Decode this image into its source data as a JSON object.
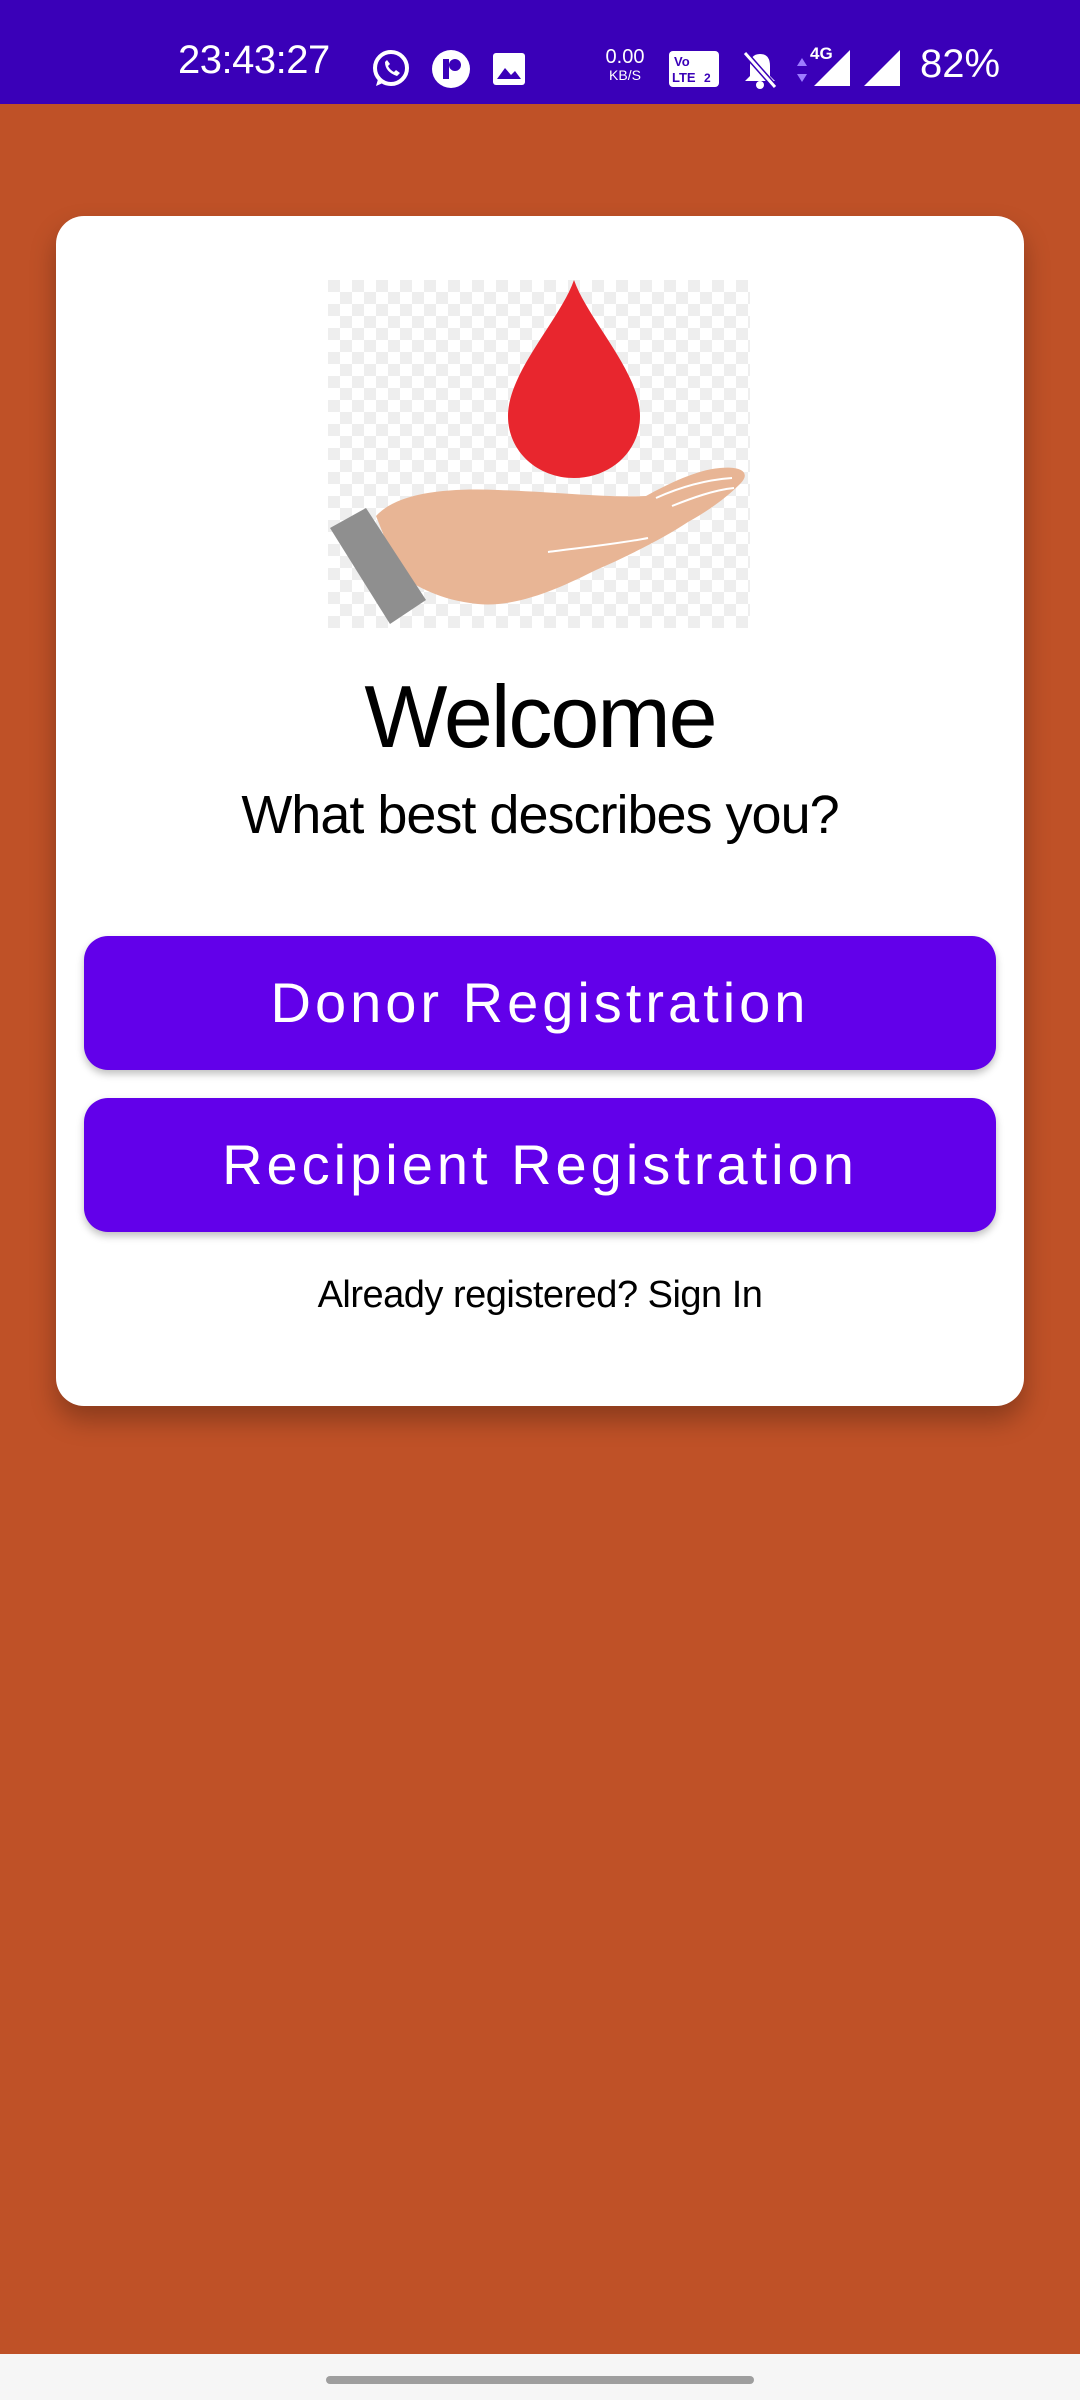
{
  "status_bar": {
    "time": "23:43:27",
    "net_speed_value": "0.00",
    "net_speed_unit": "KB/S",
    "volte_label": "Vo LTE 2",
    "network_type": "4G",
    "battery": "82%",
    "icons": [
      "whatsapp-icon",
      "app-notification-icon",
      "gallery-icon",
      "volte-icon",
      "mute-icon",
      "data-arrows-icon",
      "signal-icon",
      "signal-icon"
    ],
    "background_color": "#3a00b8"
  },
  "welcome_card": {
    "title": "Welcome",
    "subtitle": "What best describes you?",
    "donor_button_label": "Donor Registration",
    "recipient_button_label": "Recipient Registration",
    "signin_link": "Already registered? Sign In",
    "hero_image": "blood-drop-hand-icon"
  },
  "colors": {
    "background": "#bf5127",
    "button": "#6200ea",
    "card": "#ffffff",
    "blood_drop": "#e8262e"
  }
}
